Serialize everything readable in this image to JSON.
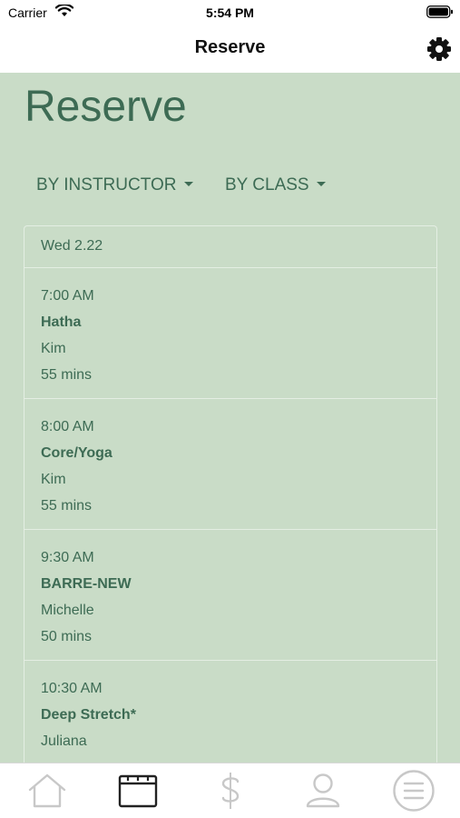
{
  "status_bar": {
    "carrier": "Carrier",
    "time": "5:54 PM"
  },
  "nav": {
    "title": "Reserve"
  },
  "page": {
    "heading": "Reserve"
  },
  "filters": {
    "instructor": "BY INSTRUCTOR",
    "class": "BY CLASS"
  },
  "schedule": {
    "date": "Wed 2.22",
    "classes": [
      {
        "time": "7:00 AM",
        "name": "Hatha",
        "instructor": "Kim",
        "duration": "55 mins"
      },
      {
        "time": "8:00 AM",
        "name": "Core/Yoga",
        "instructor": "Kim",
        "duration": "55 mins"
      },
      {
        "time": "9:30 AM",
        "name": "BARRE-NEW",
        "instructor": "Michelle",
        "duration": "50 mins"
      },
      {
        "time": "10:30 AM",
        "name": "Deep Stretch*",
        "instructor": "Juliana",
        "duration": ""
      }
    ]
  },
  "tabs": [
    {
      "icon": "home-icon",
      "active": false
    },
    {
      "icon": "calendar-icon",
      "active": true
    },
    {
      "icon": "dollar-icon",
      "active": false
    },
    {
      "icon": "user-icon",
      "active": false
    },
    {
      "icon": "menu-icon",
      "active": false
    }
  ],
  "colors": {
    "background": "#c9dcc7",
    "accent": "#3d6b54",
    "tab_active": "#222222",
    "tab_inactive": "#c8c8c8"
  }
}
